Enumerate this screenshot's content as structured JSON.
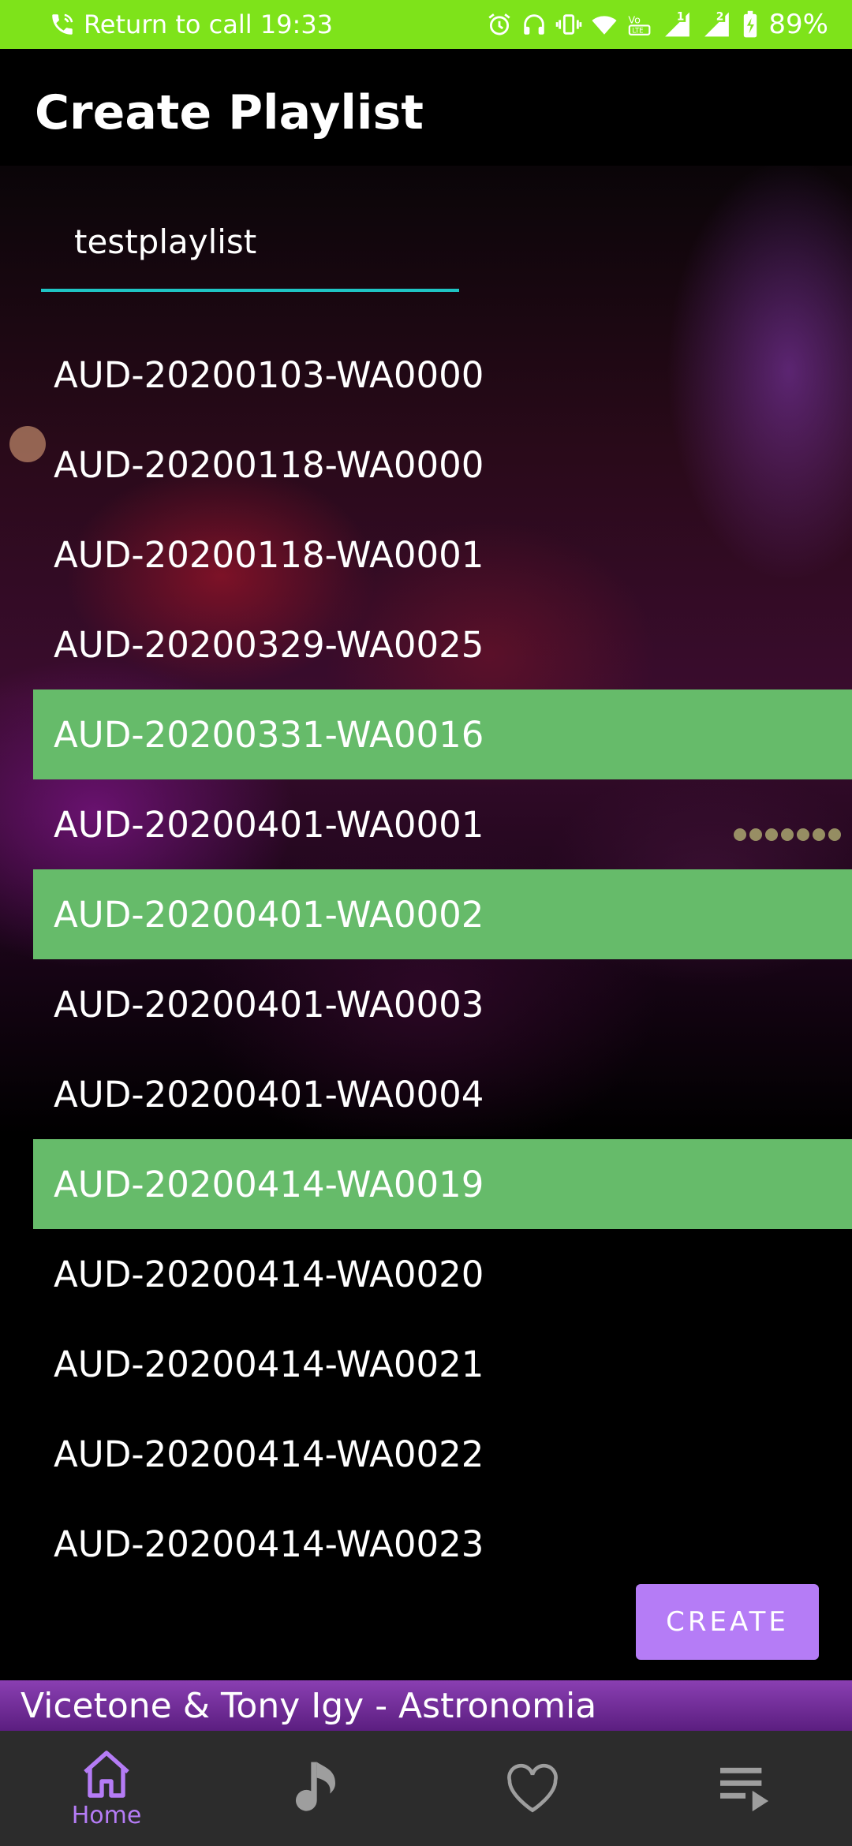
{
  "status_bar": {
    "call_text": "Return to call 19:33",
    "battery": "89%",
    "sim1": "1",
    "sim2": "2",
    "volte": "VoLTE",
    "bg_color": "#7ee31a"
  },
  "page": {
    "title": "Create Playlist"
  },
  "playlist_name_input": {
    "value": "testplaylist",
    "underline_color": "#1fc4c4"
  },
  "songs": [
    {
      "name": "AUD-20200103-WA0000",
      "selected": false
    },
    {
      "name": "AUD-20200118-WA0000",
      "selected": false
    },
    {
      "name": "AUD-20200118-WA0001",
      "selected": false
    },
    {
      "name": "AUD-20200329-WA0025",
      "selected": false
    },
    {
      "name": "AUD-20200331-WA0016",
      "selected": true
    },
    {
      "name": "AUD-20200401-WA0001",
      "selected": false
    },
    {
      "name": "AUD-20200401-WA0002",
      "selected": true
    },
    {
      "name": "AUD-20200401-WA0003",
      "selected": false
    },
    {
      "name": "AUD-20200401-WA0004",
      "selected": false
    },
    {
      "name": "AUD-20200414-WA0019",
      "selected": true
    },
    {
      "name": "AUD-20200414-WA0020",
      "selected": false
    },
    {
      "name": "AUD-20200414-WA0021",
      "selected": false
    },
    {
      "name": "AUD-20200414-WA0022",
      "selected": false
    },
    {
      "name": "AUD-20200414-WA0023",
      "selected": false
    }
  ],
  "selected_color": "#66bb6a",
  "create_button": {
    "label": "CREATE",
    "color": "#b57cf6"
  },
  "now_playing": {
    "text": "Vicetone & Tony Igy - Astronomia"
  },
  "bottom_nav": {
    "items": [
      {
        "icon": "home-icon",
        "label": "Home",
        "active": true
      },
      {
        "icon": "music-note-icon",
        "label": "",
        "active": false
      },
      {
        "icon": "heart-icon",
        "label": "",
        "active": false
      },
      {
        "icon": "queue-play-icon",
        "label": "",
        "active": false
      }
    ],
    "active_color": "#b57cf6"
  }
}
